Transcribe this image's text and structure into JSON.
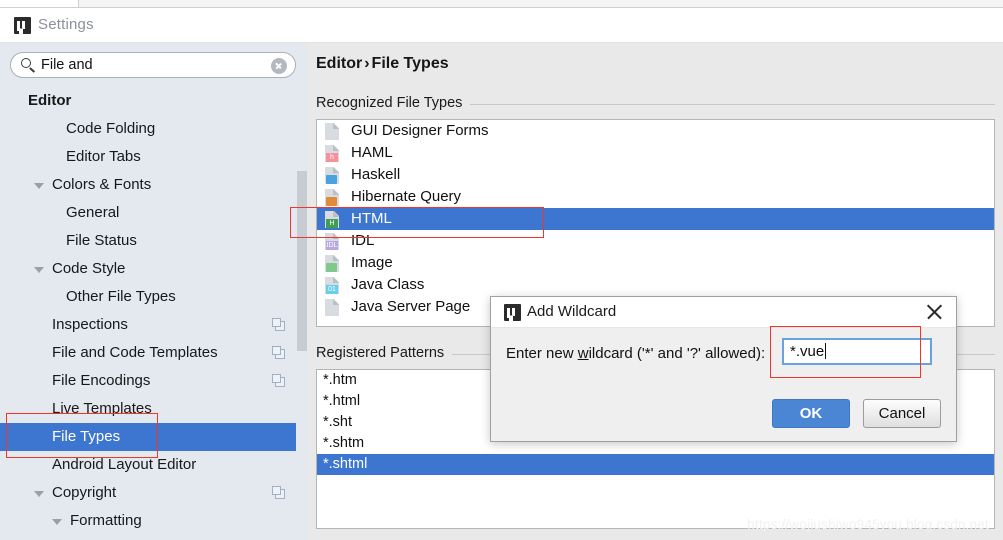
{
  "window": {
    "title": "Settings",
    "app_icon": "intellij-idea-icon"
  },
  "sidebar": {
    "search": {
      "value": "File and",
      "placeholder": "",
      "icon": "search-icon",
      "clear_icon": "clear-icon"
    },
    "items": [
      {
        "label": "Editor",
        "indent": 28,
        "bold": true,
        "arrow": "",
        "selected": false,
        "copy": false
      },
      {
        "label": "Code Folding",
        "indent": 66,
        "bold": false,
        "arrow": "",
        "selected": false,
        "copy": false
      },
      {
        "label": "Editor Tabs",
        "indent": 66,
        "bold": false,
        "arrow": "",
        "selected": false,
        "copy": false
      },
      {
        "label": "Colors & Fonts",
        "indent": 52,
        "bold": false,
        "arrow": "open",
        "selected": false,
        "copy": false
      },
      {
        "label": "General",
        "indent": 66,
        "bold": false,
        "arrow": "",
        "selected": false,
        "copy": false
      },
      {
        "label": "File Status",
        "indent": 66,
        "bold": false,
        "arrow": "",
        "selected": false,
        "copy": false
      },
      {
        "label": "Code Style",
        "indent": 52,
        "bold": false,
        "arrow": "open",
        "selected": false,
        "copy": false
      },
      {
        "label": "Other File Types",
        "indent": 66,
        "bold": false,
        "arrow": "",
        "selected": false,
        "copy": false
      },
      {
        "label": "Inspections",
        "indent": 52,
        "bold": false,
        "arrow": "",
        "selected": false,
        "copy": true
      },
      {
        "label": "File and Code Templates",
        "indent": 52,
        "bold": false,
        "arrow": "",
        "selected": false,
        "copy": true
      },
      {
        "label": "File Encodings",
        "indent": 52,
        "bold": false,
        "arrow": "",
        "selected": false,
        "copy": true
      },
      {
        "label": "Live Templates",
        "indent": 52,
        "bold": false,
        "arrow": "",
        "selected": false,
        "copy": false
      },
      {
        "label": "File Types",
        "indent": 52,
        "bold": false,
        "arrow": "",
        "selected": true,
        "copy": false
      },
      {
        "label": "Android Layout Editor",
        "indent": 52,
        "bold": false,
        "arrow": "",
        "selected": false,
        "copy": false
      },
      {
        "label": "Copyright",
        "indent": 52,
        "bold": false,
        "arrow": "open",
        "selected": false,
        "copy": true
      },
      {
        "label": "Formatting",
        "indent": 70,
        "bold": false,
        "arrow": "open",
        "selected": false,
        "copy": false
      }
    ]
  },
  "content": {
    "breadcrumb": {
      "root": "Editor",
      "separator": "›",
      "leaf": "File Types"
    },
    "recognized": {
      "group_label": "Recognized File Types",
      "rows": [
        {
          "name": "GUI Designer Forms",
          "badge": "",
          "badge_color": "",
          "selected": false
        },
        {
          "name": "HAML",
          "badge": "h",
          "badge_color": "#f6909a",
          "selected": false
        },
        {
          "name": "Haskell",
          "badge": "",
          "badge_color": "#4aa3e0",
          "selected": false
        },
        {
          "name": "Hibernate Query",
          "badge": "",
          "badge_color": "#e08a3c",
          "selected": false
        },
        {
          "name": "HTML",
          "badge": "H",
          "badge_color": "#3f9e54",
          "selected": true
        },
        {
          "name": "IDL",
          "badge": "IDL",
          "badge_color": "#b9a8e0",
          "selected": false
        },
        {
          "name": "Image",
          "badge": "",
          "badge_color": "#7fc98a",
          "selected": false
        },
        {
          "name": "Java Class",
          "badge": "01",
          "badge_color": "#67cfe8",
          "selected": false
        },
        {
          "name": "Java Server Page",
          "badge": "",
          "badge_color": "",
          "selected": false
        }
      ]
    },
    "registered": {
      "group_label": "Registered Patterns",
      "patterns": [
        {
          "value": "*.htm",
          "selected": false
        },
        {
          "value": "*.html",
          "selected": false
        },
        {
          "value": "*.sht",
          "selected": false
        },
        {
          "value": "*.shtm",
          "selected": false
        },
        {
          "value": "*.shtml",
          "selected": true
        }
      ]
    }
  },
  "dialog": {
    "title": "Add Wildcard",
    "app_icon": "intellij-idea-icon",
    "close_icon": "close-icon",
    "prompt_before": "Enter new ",
    "prompt_underlined": "w",
    "prompt_after": "ildcard ('*' and '?' allowed):",
    "input_value": "*.vue",
    "ok_label": "OK",
    "cancel_label": "Cancel"
  },
  "watermark": "https://wojiushiwo945you.blog.csdn.net",
  "colors": {
    "selection_blue": "#3d76d0",
    "annotation_red": "#f0352b",
    "ok_button_blue": "#4a86d4",
    "sidebar_bg": "#e3e9ef",
    "panel_bg": "#e9e9e9"
  }
}
